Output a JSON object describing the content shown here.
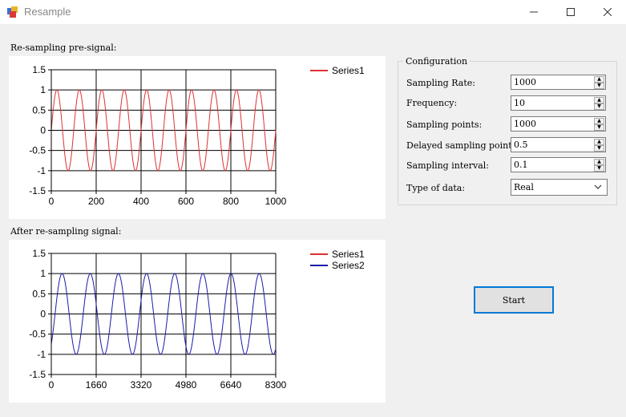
{
  "window": {
    "title": "Resample",
    "minimize_label": "—",
    "maximize_label": "☐",
    "close_label": "✕"
  },
  "pre_chart": {
    "label": "Re-sampling pre-signal:",
    "chart_data": {
      "type": "line",
      "xlim": [
        0,
        1000
      ],
      "ylim": [
        -1.5,
        1.5
      ],
      "x_ticks": [
        "0",
        "200",
        "400",
        "600",
        "800",
        "1000"
      ],
      "y_ticks": [
        "1.5",
        "1",
        "0.5",
        "0",
        "-0.5",
        "-1",
        "-1.5"
      ],
      "grid": true,
      "legend_position": "top-right",
      "series": [
        {
          "name": "Series1",
          "color": "#e03030",
          "function": "sine",
          "amplitude": 1,
          "cycles": 10,
          "x_start": 0,
          "x_end": 1000,
          "phase_deg": 0
        }
      ]
    }
  },
  "post_chart": {
    "label": "After re-sampling signal:",
    "chart_data": {
      "type": "line",
      "xlim": [
        0,
        8300
      ],
      "ylim": [
        -1.5,
        1.5
      ],
      "x_ticks": [
        "0",
        "1660",
        "3320",
        "4980",
        "6640",
        "8300"
      ],
      "y_ticks": [
        "1.5",
        "1",
        "0.5",
        "0",
        "-0.5",
        "-1",
        "-1.5"
      ],
      "grid": true,
      "legend_position": "top-right",
      "series": [
        {
          "name": "Series1",
          "color": "#e03030",
          "function": "sine",
          "amplitude": 1,
          "cycles": 0,
          "x_start": 0,
          "x_end": 8300,
          "phase_deg": 0
        },
        {
          "name": "Series2",
          "color": "#1a1aa8",
          "function": "sine",
          "amplitude": 1,
          "cycles": 7.97,
          "x_start": 0,
          "x_end": 8300,
          "phase_deg": -48
        }
      ]
    }
  },
  "config": {
    "legend": "Configuration",
    "fields": [
      {
        "label": "Sampling Rate:",
        "value": "1000"
      },
      {
        "label": "Frequency:",
        "value": "10"
      },
      {
        "label": "Sampling points:",
        "value": "1000"
      },
      {
        "label": "Delayed sampling point",
        "value": "0.5"
      },
      {
        "label": "Sampling interval:",
        "value": "0.1"
      }
    ],
    "type_label": "Type of data:",
    "type_value": "Real"
  },
  "start_label": "Start"
}
